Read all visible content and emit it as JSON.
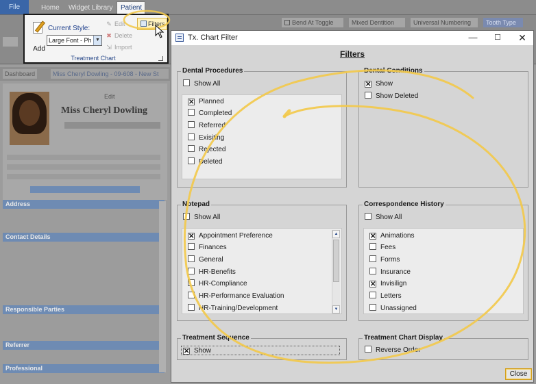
{
  "ribbon": {
    "tabs": [
      "File",
      "Home",
      "Widget Library",
      "Patient"
    ],
    "right_items": [
      "Bend At Toggle",
      "Mixed Dentition",
      "Universal Numbering",
      "Tooth Type"
    ]
  },
  "background": {
    "breadcrumbs": [
      "Dashboard",
      "Miss Cheryl Dowling - 09-608 - New St"
    ],
    "patient_name": "Miss Cheryl Dowling",
    "edit_label": "Edit",
    "sections": [
      "Address",
      "Contact Details",
      "Responsible Parties",
      "Referrer",
      "Professional"
    ]
  },
  "ribbon_popup": {
    "add_label": "Add",
    "current_style_label": "Current Style:",
    "current_style_value": "Large Font - Ph",
    "edit_label": "Edit",
    "delete_label": "Delete",
    "import_label": "Import",
    "filters_label": "Filters",
    "group_label": "Treatment Chart"
  },
  "dialog": {
    "title": "Tx. Chart Filter",
    "heading": "Filters",
    "close_label": "Close",
    "dental_procedures": {
      "title": "Dental Procedures",
      "show_all": "Show All",
      "items": [
        {
          "label": "Planned",
          "checked": true
        },
        {
          "label": "Completed",
          "checked": false
        },
        {
          "label": "Referred",
          "checked": false
        },
        {
          "label": "Exisiting",
          "checked": false
        },
        {
          "label": "Rejected",
          "checked": false
        },
        {
          "label": "Deleted",
          "checked": false
        }
      ]
    },
    "dental_conditions": {
      "title": "Dental Conditions",
      "items": [
        {
          "label": "Show",
          "checked": true
        },
        {
          "label": "Show Deleted",
          "checked": false
        }
      ]
    },
    "notepad": {
      "title": "Notepad",
      "show_all": "Show All",
      "items": [
        {
          "label": "Appointment Preference",
          "checked": true
        },
        {
          "label": "Finances",
          "checked": false
        },
        {
          "label": "General",
          "checked": false
        },
        {
          "label": "HR-Benefits",
          "checked": false
        },
        {
          "label": "HR-Compliance",
          "checked": false
        },
        {
          "label": "HR-Performance Evaluation",
          "checked": false
        },
        {
          "label": "HR-Training/Development",
          "checked": false
        }
      ]
    },
    "correspondence_history": {
      "title": "Correspondence History",
      "show_all": "Show All",
      "items": [
        {
          "label": "Animations",
          "checked": true
        },
        {
          "label": "Fees",
          "checked": false
        },
        {
          "label": "Forms",
          "checked": false
        },
        {
          "label": "Insurance",
          "checked": false
        },
        {
          "label": "Invisilign",
          "checked": true
        },
        {
          "label": "Letters",
          "checked": false
        },
        {
          "label": "Unassigned",
          "checked": false
        }
      ]
    },
    "treatment_sequence": {
      "title": "Treatment Sequence",
      "show_label": "Show",
      "show_checked": true
    },
    "treatment_chart_display": {
      "title": "Treatment Chart Display",
      "reverse_label": "Reverse Order",
      "reverse_checked": false
    }
  },
  "colors": {
    "annotation": "#f2c94c",
    "accent_blue": "#1a3c8a"
  }
}
